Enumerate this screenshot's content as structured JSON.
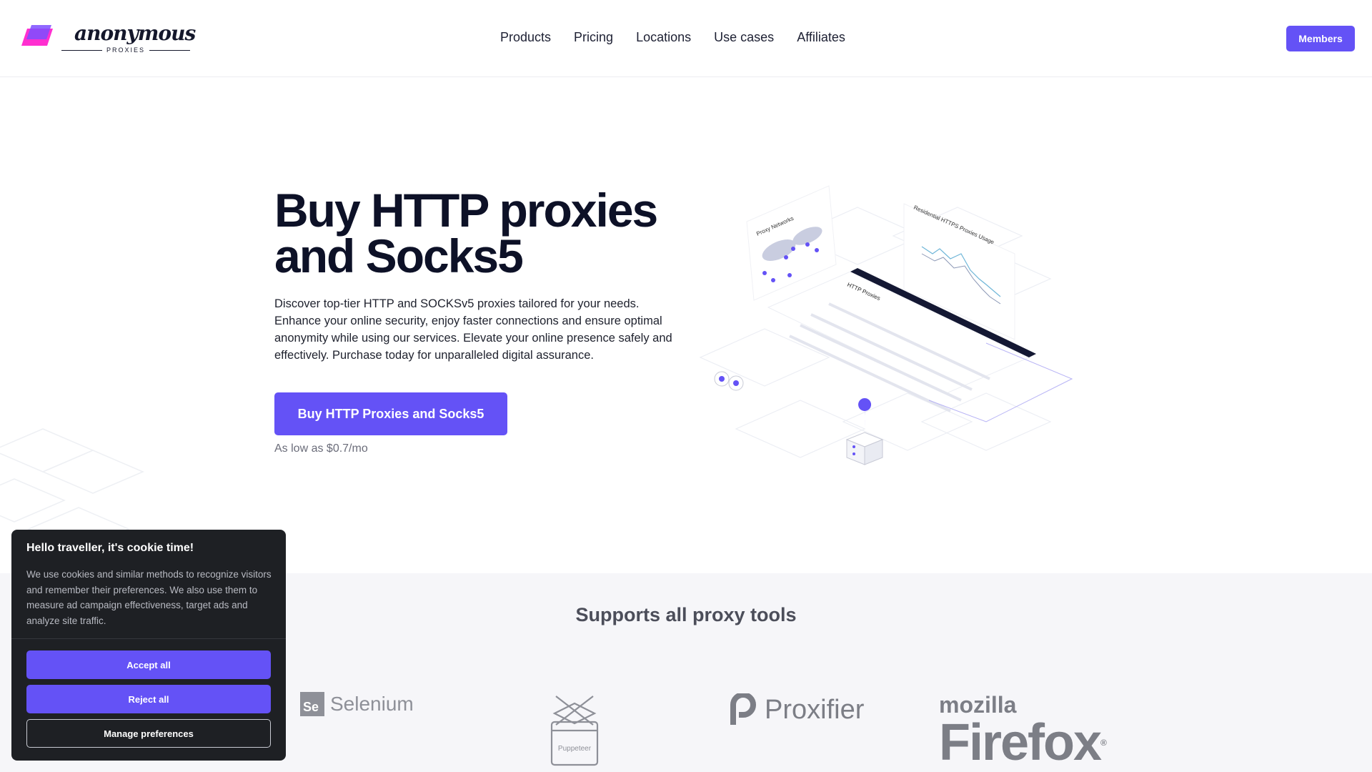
{
  "brand": {
    "name": "anonymous",
    "tagline": "PROXIES",
    "accent_color": "#6452f6",
    "logo_colors": [
      "#7c4dff",
      "#ff2fd0"
    ]
  },
  "nav": {
    "items": [
      {
        "label": "Products"
      },
      {
        "label": "Pricing"
      },
      {
        "label": "Locations"
      },
      {
        "label": "Use cases"
      },
      {
        "label": "Affiliates"
      }
    ],
    "members_label": "Members"
  },
  "hero": {
    "title_line1": "Buy HTTP proxies",
    "title_line2": "and Socks5",
    "description": "Discover top-tier HTTP and SOCKSv5 proxies tailored for your needs. Enhance your online security, enjoy faster connections and ensure optimal anonymity while using our services. Elevate your online presence safely and effectively. Purchase today for unparalleled digital assurance.",
    "cta_label": "Buy HTTP Proxies and Socks5",
    "price_note": "As low as $0.7/mo",
    "illustration": {
      "panel_proxy_networks": "Proxy Networks",
      "panel_usage": "Residential HTTPS Proxies Usage",
      "panel_table": "HTTP Proxies"
    }
  },
  "tools": {
    "title": "Supports all proxy tools",
    "logos": {
      "selenium": "Selenium",
      "selenium_badge": "Se",
      "puppeteer": "Puppeteer",
      "proxifier": "Proxifier",
      "firefox_brand": "mozilla",
      "firefox_name": "Firefox"
    }
  },
  "cookie": {
    "title": "Hello traveller, it's cookie time!",
    "text": "We use cookies and similar methods to recognize visitors and remember their preferences. We also use them to measure ad campaign effectiveness, target ads and analyze site traffic.",
    "accept_label": "Accept all",
    "reject_label": "Reject all",
    "manage_label": "Manage preferences"
  }
}
